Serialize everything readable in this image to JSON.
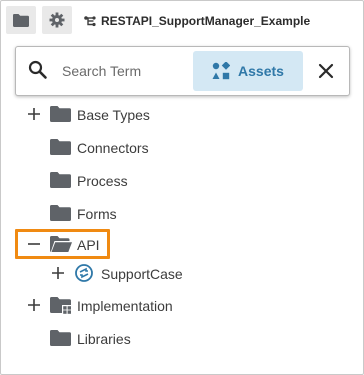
{
  "header": {
    "folder_button": "folder-icon",
    "settings_button": "gear-icon",
    "project_icon": "project-tree-icon",
    "project_name": "RESTAPI_SupportManager_Example"
  },
  "search": {
    "placeholder": "Search Term",
    "value": "",
    "assets_label": "Assets",
    "assets_icon": "assets-icon",
    "close_icon": "close-icon"
  },
  "tree": {
    "items": [
      {
        "label": "Base Types",
        "toggle": "+",
        "icon": "folder-icon"
      },
      {
        "label": "Connectors",
        "toggle": "",
        "icon": "folder-icon"
      },
      {
        "label": "Process",
        "toggle": "",
        "icon": "folder-icon"
      },
      {
        "label": "Forms",
        "toggle": "",
        "icon": "folder-icon"
      },
      {
        "label": "API",
        "toggle": "−",
        "icon": "folder-open-icon",
        "highlighted": true
      },
      {
        "label": "SupportCase",
        "toggle": "+",
        "icon": "rest-api-icon"
      },
      {
        "label": "Implementation",
        "toggle": "+",
        "icon": "folder-grid-icon"
      },
      {
        "label": "Libraries",
        "toggle": "",
        "icon": "folder-icon"
      }
    ]
  },
  "colors": {
    "accent": "#2f78a8",
    "accent_bg": "#d4e8f4",
    "folder": "#5f6368",
    "highlight": "#f08a12"
  }
}
